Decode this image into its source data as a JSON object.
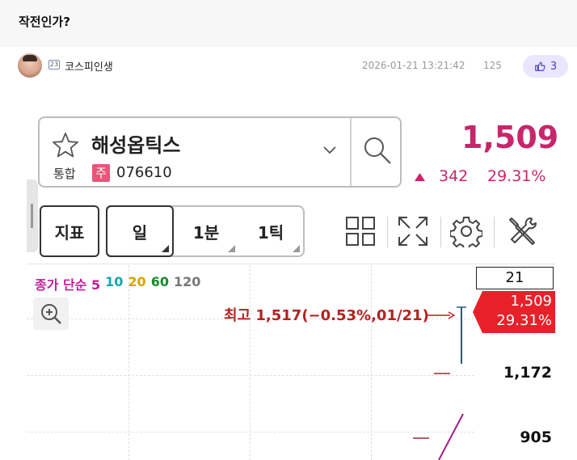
{
  "post": {
    "title": "작전인가?",
    "author": "코스피인생",
    "level_badge": "23",
    "date": "2026-01-21 13:21:42",
    "views": "125",
    "likes": "3"
  },
  "stock": {
    "name": "해성옵틱스",
    "market": "통합",
    "market_badge": "주",
    "code": "076610",
    "price": "1,509",
    "change": "342",
    "change_pct": "29.31%"
  },
  "toolbar": {
    "indicator_label": "지표",
    "periods": [
      {
        "label": "일",
        "active": true
      },
      {
        "label": "1분",
        "active": false
      },
      {
        "label": "1틱",
        "active": false
      }
    ],
    "icons": [
      "layout-grid-icon",
      "fullscreen-icon",
      "settings-gear-icon",
      "tools-icon"
    ]
  },
  "chart": {
    "ma_legend": [
      {
        "label": "종가 단순 5",
        "color": "#c0209a"
      },
      {
        "label": "10",
        "color": "#1aa3b3"
      },
      {
        "label": "20",
        "color": "#d9a300"
      },
      {
        "label": "60",
        "color": "#1a8a2a"
      },
      {
        "label": "120",
        "color": "#777777"
      }
    ],
    "high_note": "최고 1,517(−0.53%,01/21)",
    "axis_top": "21",
    "current_price": "1,509",
    "current_pct": "29.31%",
    "axis_labels": [
      "1,172",
      "905"
    ],
    "colors": {
      "up": "#c8266a",
      "tag": "#e8202a",
      "note": "#b3231f"
    }
  }
}
